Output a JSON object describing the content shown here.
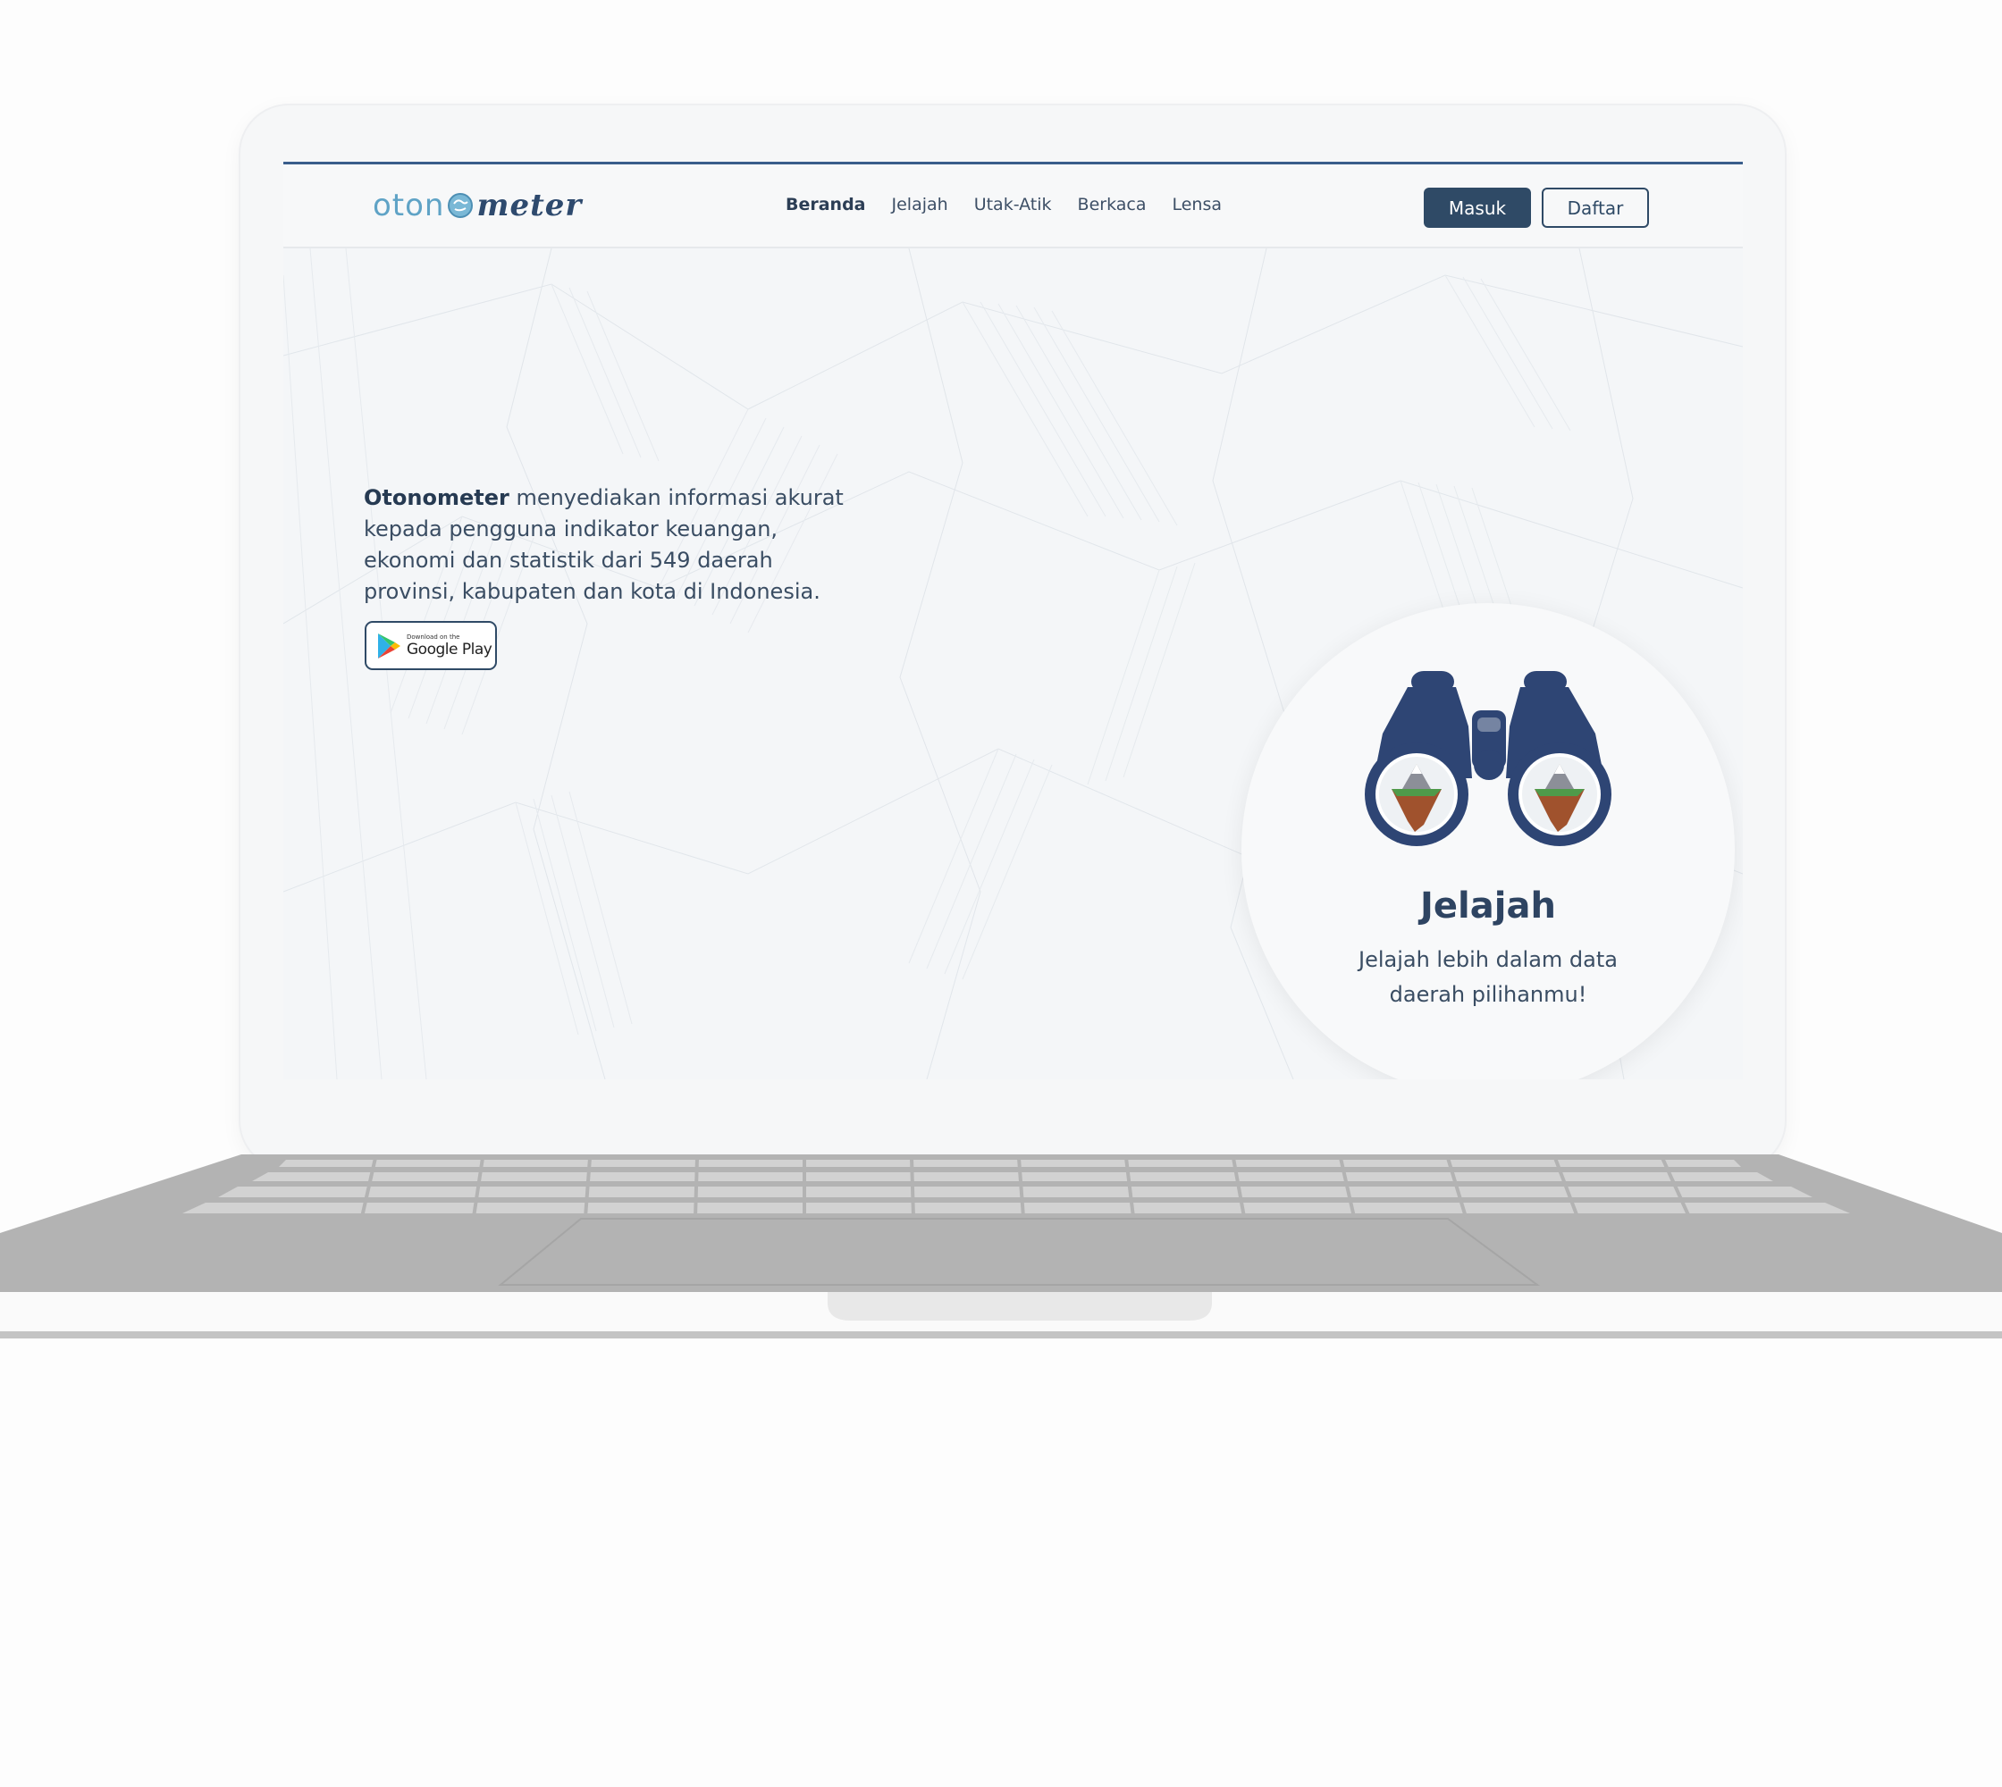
{
  "navbar": {
    "logo_light": "oton",
    "logo_dark": "meter",
    "menu": [
      {
        "label": "Beranda",
        "active": true
      },
      {
        "label": "Jelajah",
        "active": false
      },
      {
        "label": "Utak-Atik",
        "active": false
      },
      {
        "label": "Berkaca",
        "active": false
      },
      {
        "label": "Lensa",
        "active": false
      }
    ],
    "login_label": "Masuk",
    "register_label": "Daftar"
  },
  "hero": {
    "brand": "Otonometer",
    "description": " menyediakan informasi akurat kepada pengguna indikator keuangan, ekonomi dan statistik dari 549 daerah provinsi, kabupaten dan kota di Indonesia.",
    "store_badge_small": "Download on the",
    "store_badge_big": "Google Play"
  },
  "feature": {
    "icon": "binoculars-icon",
    "title": "Jelajah",
    "desc": "Jelajah lebih dalam data daerah pilihanmu!"
  },
  "colors": {
    "primary": "#2f4a66",
    "accent_line": "#3a5e8c",
    "logo_light": "#5fa3c6"
  }
}
